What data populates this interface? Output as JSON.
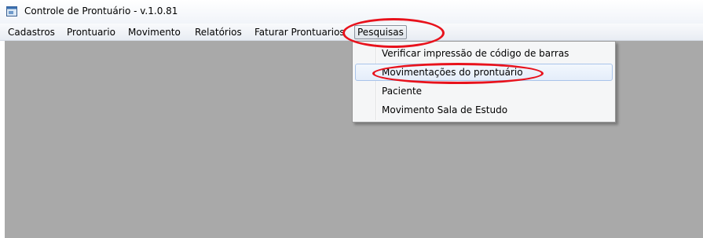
{
  "window": {
    "title": "Controle de Prontuário - v.1.0.81",
    "icon": "app-window-icon"
  },
  "menubar": {
    "items": [
      {
        "label": "Cadastros"
      },
      {
        "label": "Prontuario"
      },
      {
        "label": "Movimento"
      },
      {
        "label": "Relatórios"
      },
      {
        "label": "Faturar Prontuarios"
      },
      {
        "label": "Pesquisas",
        "active": true
      }
    ]
  },
  "dropdown": {
    "items": [
      {
        "label": "Verificar impressão de código de barras"
      },
      {
        "label": "Movimentações do prontuário",
        "hover": true
      },
      {
        "label": "Paciente"
      },
      {
        "label": "Movimento Sala de Estudo"
      }
    ]
  },
  "colors": {
    "client_background": "#a9a9a9",
    "annotation": "#e8121c",
    "menu_hover_border": "#a9c4ea"
  }
}
